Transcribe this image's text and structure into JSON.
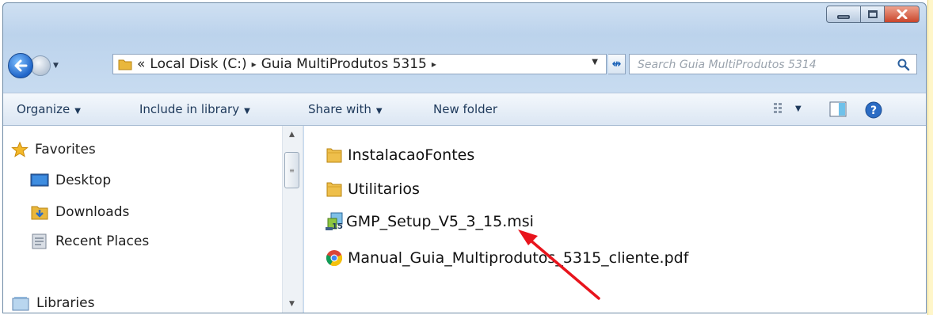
{
  "window": {
    "colors": {
      "accent": "#1f64c8",
      "close": "#c9452b",
      "annotation_arrow": "#e8141c"
    }
  },
  "address": {
    "history_prefix": "«",
    "crumbs": [
      "Local Disk (C:)",
      "Guia MultiProdutos 5315"
    ],
    "separator": "▸"
  },
  "search": {
    "placeholder": "Search Guia MultiProdutos 5314"
  },
  "toolbar": {
    "organize": "Organize",
    "include_in_library": "Include in library",
    "share_with": "Share with",
    "new_folder": "New folder"
  },
  "nav_pane": {
    "favorites": "Favorites",
    "items": [
      "Desktop",
      "Downloads",
      "Recent Places"
    ],
    "libraries": "Libraries"
  },
  "files": [
    {
      "name": "InstalacaoFontes",
      "icon": "folder-icon"
    },
    {
      "name": "Utilitarios",
      "icon": "folder-icon"
    },
    {
      "name": "GMP_Setup_V5_3_15.msi",
      "icon": "msi-installer-icon"
    },
    {
      "name": "Manual_Guia_Multiprodutos_5315_cliente.pdf",
      "icon": "chrome-pdf-icon"
    }
  ]
}
